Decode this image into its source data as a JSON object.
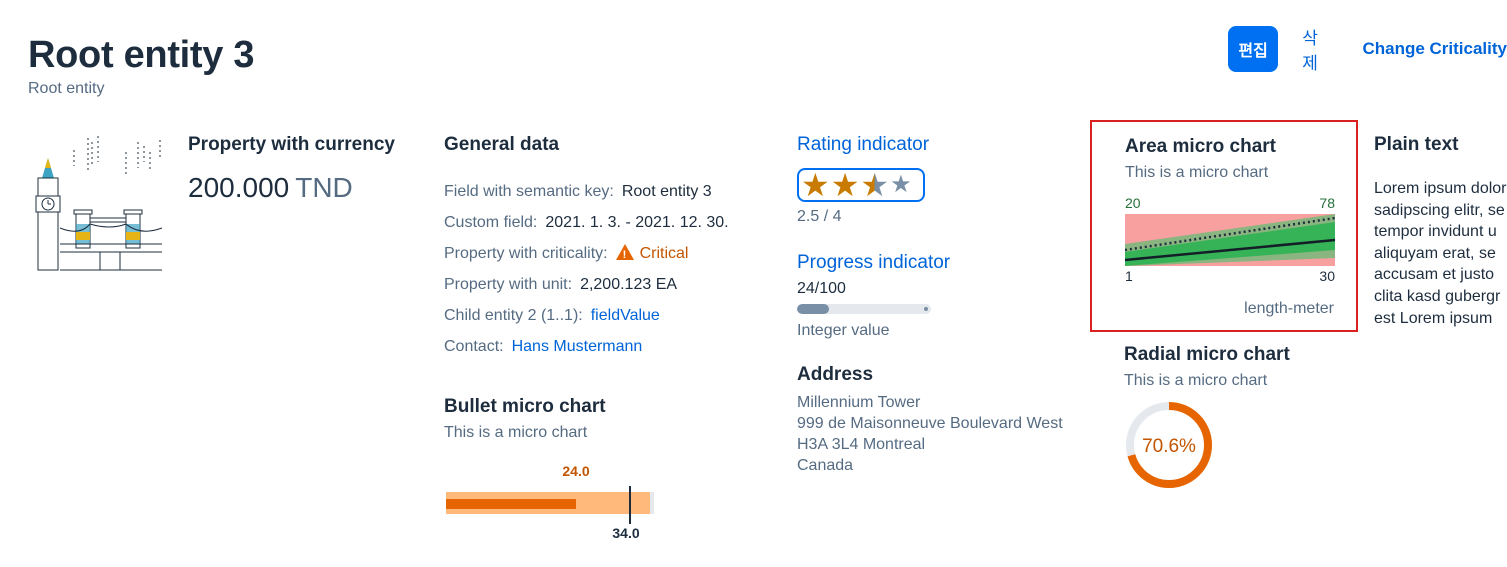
{
  "header": {
    "title": "Root entity 3",
    "subtitle": "Root entity",
    "actions": {
      "edit": "편집",
      "delete": "삭제",
      "change_criticality": "Change Criticality"
    }
  },
  "currency": {
    "label": "Property with currency",
    "amount": "200.000",
    "unit": "TND"
  },
  "general": {
    "title": "General data",
    "fields": {
      "semantic_key_label": "Field with semantic key:",
      "semantic_key_value": "Root entity 3",
      "custom_label": "Custom field:",
      "custom_value": "2021. 1. 3. - 2021. 12. 30.",
      "criticality_label": "Property with criticality:",
      "criticality_value": "Critical",
      "unit_label": "Property with unit:",
      "unit_value": "2,200.123 EA",
      "child_label": "Child entity 2 (1..1):",
      "child_value": "fieldValue",
      "contact_label": "Contact:",
      "contact_value": "Hans Mustermann"
    }
  },
  "bullet": {
    "title": "Bullet micro chart",
    "subtitle": "This is a micro chart",
    "actual_label": "24.0",
    "target_label": "34.0"
  },
  "rating": {
    "title": "Rating indicator",
    "value": 2.5,
    "max": 4,
    "label": "2.5 / 4"
  },
  "progress": {
    "title": "Progress indicator",
    "value_text": "24/100",
    "percent": 24,
    "label": "Integer value"
  },
  "address": {
    "title": "Address",
    "lines": [
      "Millennium Tower",
      "999 de Maisonneuve Boulevard West",
      "H3A 3L4 Montreal",
      "Canada"
    ]
  },
  "area": {
    "title": "Area micro chart",
    "subtitle": "This is a micro chart",
    "start_value": "20",
    "end_value": "78",
    "x_start": "1",
    "x_end": "30",
    "unit": "length-meter"
  },
  "radial": {
    "title": "Radial micro chart",
    "subtitle": "This is a micro chart",
    "value": 70.6,
    "label": "70.6%"
  },
  "plain": {
    "title": "Plain text",
    "text": "Lorem ipsum dolor\nsadipscing elitr, se\ntempor invidunt u\naliquyam erat, se\naccusam et justo\nclita kasd gubergr\nest Lorem ipsum"
  },
  "colors": {
    "accent": "#0070f2",
    "critical": "#e76500",
    "highlight_border": "#d9211f"
  }
}
